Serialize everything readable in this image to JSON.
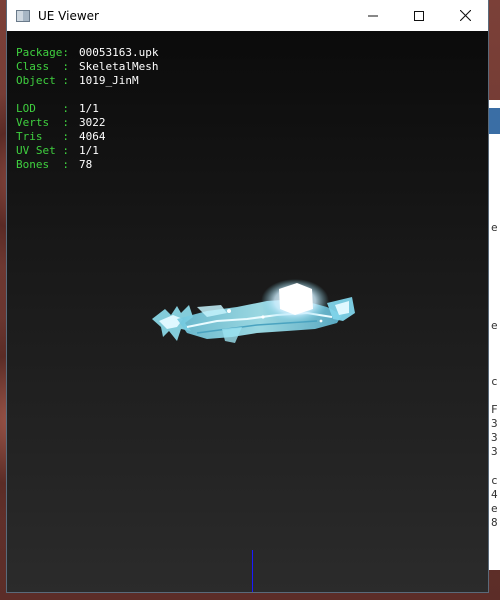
{
  "window": {
    "title": "UE Viewer",
    "minimize_icon": "minimize-icon",
    "maximize_icon": "maximize-icon",
    "close_icon": "close-icon"
  },
  "info": {
    "package": {
      "label": "Package:",
      "value": "00053163.upk"
    },
    "class": {
      "label": "Class  :",
      "value": "SkeletalMesh"
    },
    "object": {
      "label": "Object :",
      "value": "1019_JinM"
    },
    "lod": {
      "label": "LOD    :",
      "value": "1/1"
    },
    "verts": {
      "label": "Verts  :",
      "value": "3022"
    },
    "tris": {
      "label": "Tris   :",
      "value": "4064"
    },
    "uvset": {
      "label": "UV Set :",
      "value": "1/1"
    },
    "bones": {
      "label": "Bones  :",
      "value": "78"
    }
  },
  "background_peek": [
    "e",
    "e",
    "c",
    "F",
    "3",
    "3",
    "3",
    "c",
    "4",
    "e",
    "8"
  ],
  "colors": {
    "label_green": "#3fd03f",
    "value_white": "#ffffff",
    "axis_blue": "#1a1aff"
  }
}
